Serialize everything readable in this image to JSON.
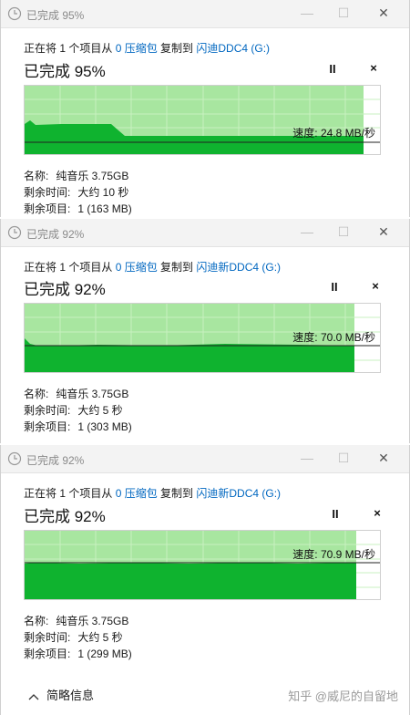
{
  "dialogs": [
    {
      "title": "已完成 95%",
      "copy": {
        "prefix": "正在将 1 个项目从 ",
        "source": "0 压缩包",
        "middle": " 复制到 ",
        "dest": "闪迪DDC4 (G:)"
      },
      "percent_label": "已完成 95%",
      "pause_label": "II",
      "close_label": "×",
      "speed": "速度: 24.8 MB/秒",
      "progress": 0.95,
      "name_label": "名称:",
      "name": "纯音乐 3.75GB",
      "time_label": "剩余时间:",
      "time": "大约 10 秒",
      "items_label": "剩余项目:",
      "items": "1 (163 MB)"
    },
    {
      "title": "已完成 92%",
      "copy": {
        "prefix": "正在将 1 个项目从 ",
        "source": "0 压缩包",
        "middle": " 复制到 ",
        "dest": "闪迪新DDC4 (G:)"
      },
      "percent_label": "已完成 92%",
      "pause_label": "II",
      "close_label": "×",
      "speed": "速度: 70.0 MB/秒",
      "progress": 0.92,
      "name_label": "名称:",
      "name": "纯音乐 3.75GB",
      "time_label": "剩余时间:",
      "time": "大约 5 秒",
      "items_label": "剩余项目:",
      "items": "1 (303 MB)"
    },
    {
      "title": "已完成 92%",
      "copy": {
        "prefix": "正在将 1 个项目从 ",
        "source": "0 压缩包",
        "middle": " 复制到 ",
        "dest": "闪迪新DDC4 (G:)"
      },
      "percent_label": "已完成 92%",
      "pause_label": "II",
      "close_label": "×",
      "speed": "速度: 70.9 MB/秒",
      "progress": 0.92,
      "name_label": "名称:",
      "name": "纯音乐 3.75GB",
      "time_label": "剩余时间:",
      "time": "大约 5 秒",
      "items_label": "剩余项目:",
      "items": "1 (299 MB)"
    }
  ],
  "window_controls": {
    "minimize": "—",
    "maximize": "☐",
    "close": "✕"
  },
  "footer": {
    "summary_label": "简略信息",
    "watermark": "知乎 @威尼的自留地"
  },
  "colors": {
    "progress_fill": "#a8e6a0",
    "speed_fill": "#0fb32f",
    "link": "#0067c0"
  },
  "icons": {
    "title": "clock-icon",
    "pause": "pause-icon",
    "cancel": "close-icon",
    "collapse": "chevron-up-icon"
  }
}
